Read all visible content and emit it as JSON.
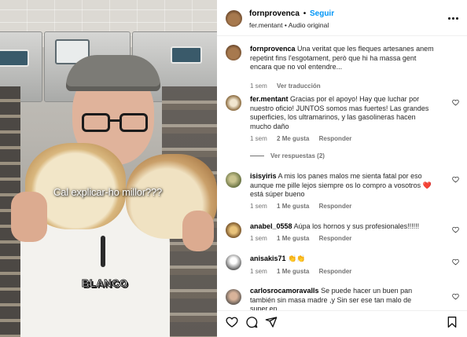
{
  "video": {
    "caption": "Cal explicar-ho millor???",
    "sticker": "BLANCO"
  },
  "post": {
    "author": "fornprovenca",
    "separator": "•",
    "follow_label": "Seguir",
    "audio": "fer.mentant • Audio original",
    "more_icon": "more-horizontal-icon"
  },
  "caption_comment": {
    "username": "fornprovenca",
    "text": "Una veritat que les fleques artesanes anem repetint fins l'esgotament, però que hi ha massa gent encara que no vol entendre...",
    "time": "1 sem",
    "translate_label": "Ver traducción"
  },
  "comments": [
    {
      "username": "fer.mentant",
      "text": "Gracias por el apoyo! Hay que luchar por nuestro oficio! JUNTOS somos mas fuertes! Las grandes superficies, los ultramarinos, y las gasolineras hacen mucho daño",
      "time": "1 sem",
      "likes": "2 Me gusta",
      "reply_label": "Responder",
      "view_replies": "Ver respuestas (2)"
    },
    {
      "username": "isisyiris",
      "text": "A mis los panes malos me sienta fatal por eso aunque me pille lejos siempre os lo compro a vosotros ❤️ está súper bueno",
      "time": "1 sem",
      "likes": "1 Me gusta",
      "reply_label": "Responder"
    },
    {
      "username": "anabel_0558",
      "text": "Aúpa los hornos y sus profesionales!!!!!!",
      "time": "1 sem",
      "likes": "1 Me gusta",
      "reply_label": "Responder"
    },
    {
      "username": "anisakis71",
      "text": "👏👏",
      "time": "1 sem",
      "likes": "1 Me gusta",
      "reply_label": "Responder"
    },
    {
      "username": "carlosrocamoravalls",
      "text": "Se puede hacer un buen pan también sin masa madre ,y Sin ser ese tan malo de super,en",
      "time": "",
      "likes": "",
      "reply_label": ""
    }
  ],
  "icons": {
    "like": "heart-icon",
    "comment": "comment-icon",
    "share": "send-icon",
    "save": "bookmark-icon"
  },
  "colors": {
    "follow": "#0095f6",
    "heart_red": "#e0245e",
    "meta_gray": "#737373"
  }
}
